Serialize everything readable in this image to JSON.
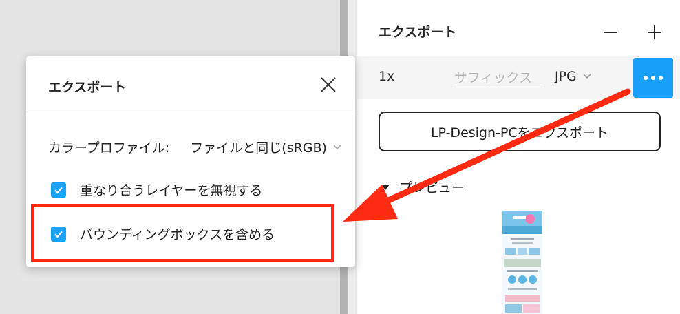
{
  "panel": {
    "title": "エクスポート",
    "minus_icon": "minus-icon",
    "plus_icon": "plus-icon",
    "export_row": {
      "scale": "1x",
      "suffix_placeholder": "サフィックス",
      "format": "JPG",
      "more_icon": "more-horizontal-icon"
    },
    "export_button": "LP-Design-PCをエクスポート",
    "preview_label": "プレビュー"
  },
  "dialog": {
    "title": "エクスポート",
    "close_icon": "close-icon",
    "color_profile_label": "カラープロファイル:",
    "color_profile_value": "ファイルと同じ(sRGB)",
    "options": [
      {
        "label": "重なり合うレイヤーを無視する",
        "checked": true
      },
      {
        "label": "バウンディングボックスを含める",
        "checked": true
      }
    ]
  },
  "annotation": {
    "highlight_color": "#ff2a12"
  },
  "colors": {
    "accent": "#18a0fb"
  }
}
